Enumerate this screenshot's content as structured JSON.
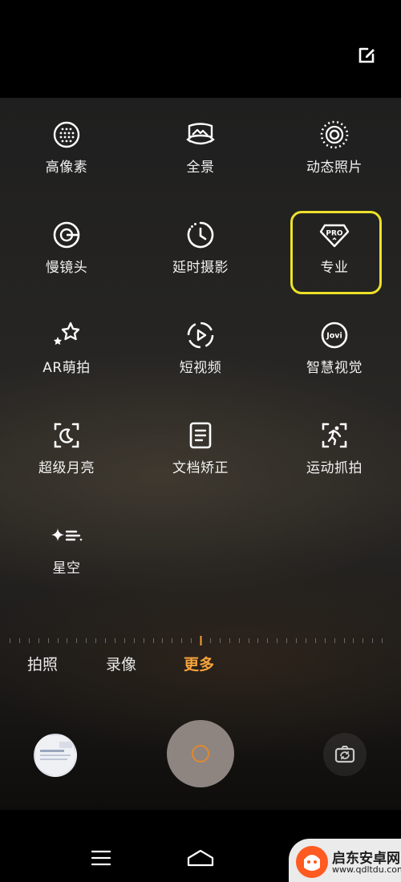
{
  "header": {
    "edit_icon": "edit-icon"
  },
  "modes": [
    {
      "label": "高像素",
      "icon": "high-pixel-icon"
    },
    {
      "label": "全景",
      "icon": "panorama-icon"
    },
    {
      "label": "动态照片",
      "icon": "live-photo-icon"
    },
    {
      "label": "慢镜头",
      "icon": "slow-motion-icon"
    },
    {
      "label": "延时摄影",
      "icon": "timelapse-icon"
    },
    {
      "label": "专业",
      "icon": "pro-icon"
    },
    {
      "label": "AR萌拍",
      "icon": "ar-stars-icon"
    },
    {
      "label": "短视频",
      "icon": "short-video-icon"
    },
    {
      "label": "智慧视觉",
      "icon": "jovi-icon"
    },
    {
      "label": "超级月亮",
      "icon": "super-moon-icon"
    },
    {
      "label": "文档矫正",
      "icon": "document-icon"
    },
    {
      "label": "运动抓拍",
      "icon": "sport-icon"
    },
    {
      "label": "星空",
      "icon": "starry-sky-icon"
    }
  ],
  "tabs": [
    {
      "label": "拍照",
      "active": false
    },
    {
      "label": "录像",
      "active": false
    },
    {
      "label": "更多",
      "active": true
    }
  ],
  "colors": {
    "accent": "#f6a23c",
    "highlight": "#ece12a",
    "shutter": "#8e8580"
  },
  "watermark": {
    "name": "启东安卓网",
    "url": "www.qdltdu.com"
  }
}
